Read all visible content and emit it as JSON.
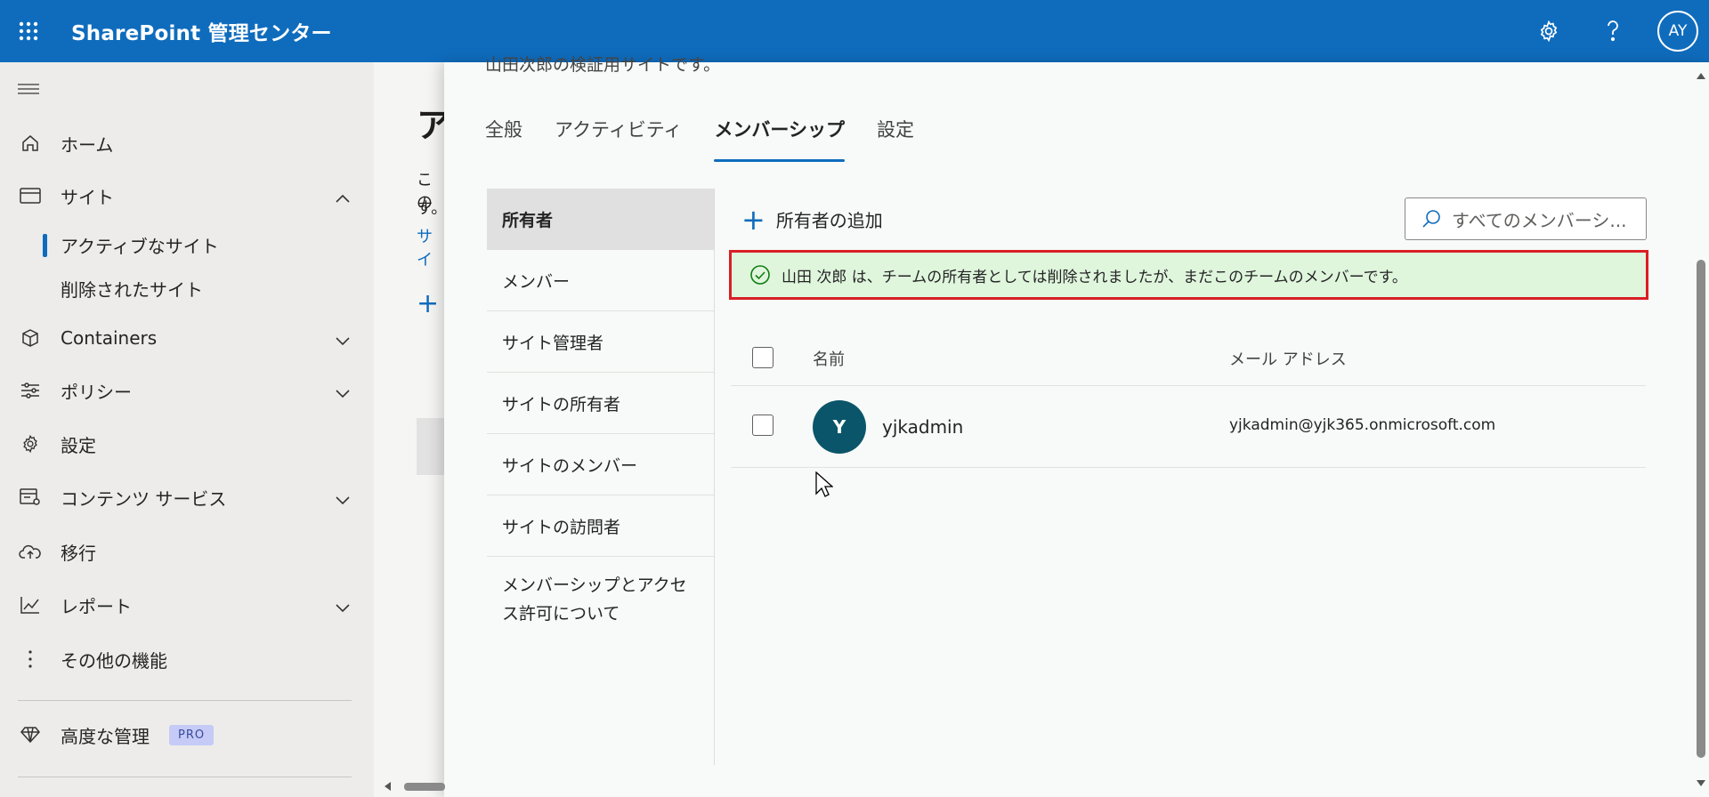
{
  "header": {
    "app_title": "SharePoint 管理センター",
    "avatar_initials": "AY",
    "accent_color": "#0f6cbd"
  },
  "leftnav": {
    "items": [
      {
        "label": "ホーム",
        "icon": "home-icon"
      },
      {
        "label": "サイト",
        "icon": "site-icon",
        "expanded": true
      },
      {
        "label": "Containers",
        "icon": "cube-icon"
      },
      {
        "label": "ポリシー",
        "icon": "sliders-icon"
      },
      {
        "label": "設定",
        "icon": "gear-icon"
      },
      {
        "label": "コンテンツ サービス",
        "icon": "content-services-icon"
      },
      {
        "label": "移行",
        "icon": "cloud-upload-icon"
      },
      {
        "label": "レポート",
        "icon": "chart-icon"
      },
      {
        "label": "その他の機能",
        "icon": "more-icon"
      },
      {
        "label": "高度な管理",
        "icon": "diamond-icon"
      }
    ],
    "sub_items": [
      "アクティブなサイト",
      "削除されたサイト"
    ],
    "pro_badge": "PRO"
  },
  "background_page": {
    "heading": "ア",
    "line1": "この",
    "line2": "す。",
    "link": "サイ"
  },
  "panel": {
    "cut_text": "山田次郎の検証用サイトです。",
    "tabs": [
      "全般",
      "アクティビティ",
      "メンバーシップ",
      "設定"
    ],
    "active_tab": "メンバーシップ",
    "subnav": [
      "所有者",
      "メンバー",
      "サイト管理者",
      "サイトの所有者",
      "サイトのメンバー",
      "サイトの訪問者",
      "メンバーシップとアクセス許可について"
    ],
    "selected_subnav": "所有者",
    "add_owner_label": "所有者の追加",
    "search_placeholder": "すべてのメンバーシ...",
    "banner_text": "山田 次郎 は、チームの所有者としては削除されましたが、まだこのチームのメンバーです。",
    "table": {
      "columns": [
        "名前",
        "メール アドレス"
      ],
      "rows": [
        {
          "initial": "Y",
          "name": "yjkadmin",
          "email": "yjkadmin@yjk365.onmicrosoft.com"
        }
      ]
    }
  }
}
